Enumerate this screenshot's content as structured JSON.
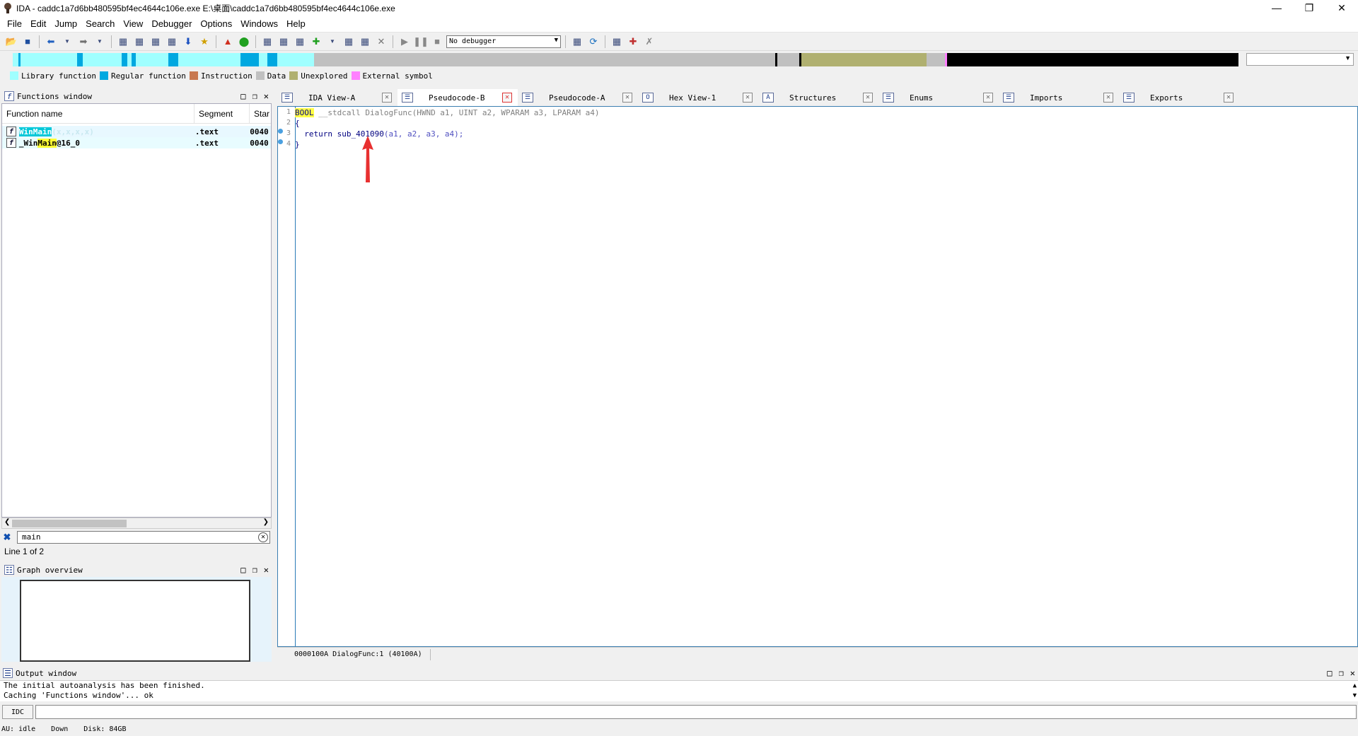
{
  "window": {
    "title": "IDA - caddc1a7d6bb480595bf4ec4644c106e.exe E:\\桌面\\caddc1a7d6bb480595bf4ec4644c106e.exe",
    "app_icon": "ida-icon",
    "controls": [
      "minimize-icon",
      "restore-icon",
      "close-icon"
    ]
  },
  "menu": [
    "File",
    "Edit",
    "Jump",
    "Search",
    "View",
    "Debugger",
    "Options",
    "Windows",
    "Help"
  ],
  "toolbar": {
    "debugger_select": "No debugger"
  },
  "navband_colors": {
    "library": "#a0ffff",
    "regular": "#00a8e0",
    "instruction": "#c87850",
    "data": "#c0c0c0",
    "unexplored": "#b0b070",
    "external": "#ff80ff"
  },
  "legend": {
    "items": [
      {
        "label": "Library function",
        "color": "#a0ffff"
      },
      {
        "label": "Regular function",
        "color": "#00a8e0"
      },
      {
        "label": "Instruction",
        "color": "#c87850"
      },
      {
        "label": "Data",
        "color": "#c0c0c0"
      },
      {
        "label": "Unexplored",
        "color": "#b0b070"
      },
      {
        "label": "External symbol",
        "color": "#ff80ff"
      }
    ]
  },
  "functions_window": {
    "title": "Functions window",
    "columns": [
      "Function name",
      "Segment",
      "Star"
    ],
    "rows": [
      {
        "prefix": "",
        "highlight": "WinMain",
        "suffix": "(x,x,x,x)",
        "segment": ".text",
        "start": "0040"
      },
      {
        "prefix": "_Win",
        "highlight": "Main",
        "suffix": "@16_0",
        "segment": ".text",
        "start": "0040"
      }
    ],
    "filter": "main",
    "line_status": "Line 1 of 2"
  },
  "graph_overview": {
    "title": "Graph overview"
  },
  "tabs": [
    {
      "label": "IDA View-A",
      "icon": "disassembly-icon",
      "active": false
    },
    {
      "label": "Pseudocode-B",
      "icon": "pseudocode-icon",
      "active": true
    },
    {
      "label": "Pseudocode-A",
      "icon": "pseudocode-icon",
      "active": false
    },
    {
      "label": "Hex View-1",
      "icon": "hex-icon",
      "active": false
    },
    {
      "label": "Structures",
      "icon": "structures-icon",
      "active": false
    },
    {
      "label": "Enums",
      "icon": "enums-icon",
      "active": false
    },
    {
      "label": "Imports",
      "icon": "imports-icon",
      "active": false
    },
    {
      "label": "Exports",
      "icon": "exports-icon",
      "active": false
    }
  ],
  "code": {
    "lines": [
      {
        "num": "1",
        "kw": "BOOL",
        "text": " __stdcall DialogFunc(HWND a1, UINT a2, WPARAM a3, LPARAM a4)"
      },
      {
        "num": "2",
        "text": "{"
      },
      {
        "num": "3",
        "ret": "  return ",
        "call": "sub_401090",
        "args": "(a1, a2, a3, a4);"
      },
      {
        "num": "4",
        "text": "}"
      }
    ],
    "status": "0000100A DialogFunc:1 (40100A)"
  },
  "output_window": {
    "title": "Output window",
    "lines": [
      "The initial autoanalysis has been finished.",
      "Caching 'Functions window'... ok"
    ],
    "idc_label": "IDC"
  },
  "statusbar": {
    "au": "AU:  idle",
    "direction": "Down",
    "disk": "Disk: 84GB"
  }
}
